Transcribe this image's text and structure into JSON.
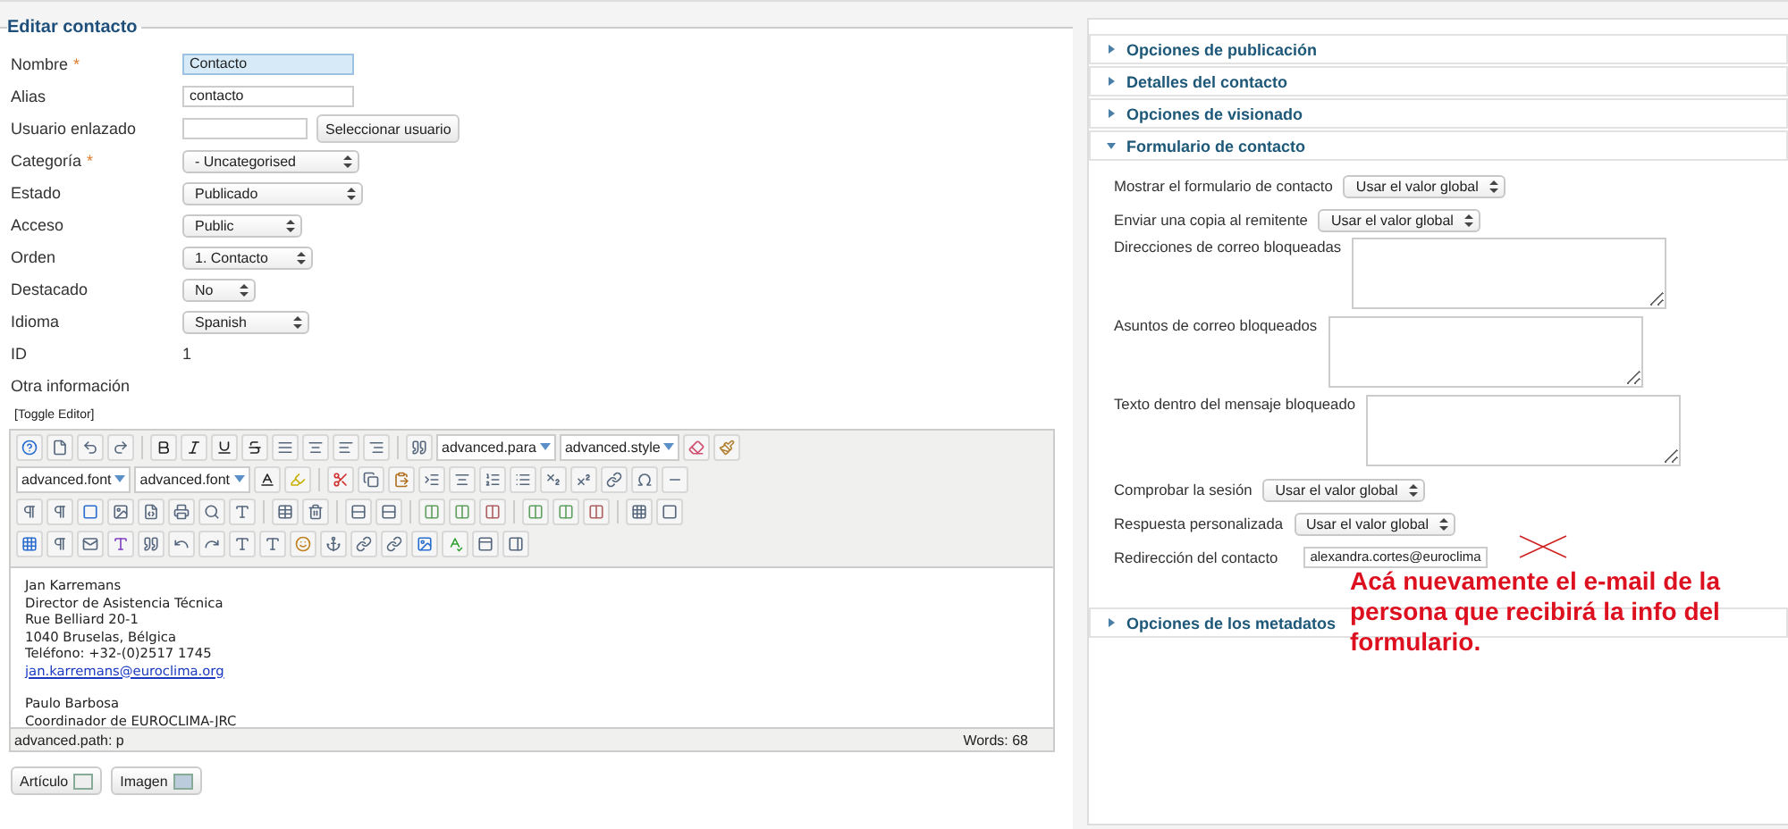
{
  "form": {
    "legend": "Editar contacto",
    "fields": [
      {
        "kind": "text",
        "label": "Nombre",
        "required_mark": "*",
        "value": "Contacto",
        "focused": true
      },
      {
        "kind": "text",
        "label": "Alias",
        "value": "contacto",
        "focused": false
      },
      {
        "kind": "user",
        "label": "Usuario enlazado",
        "button": "Seleccionar usuario"
      },
      {
        "kind": "select",
        "label": "Categoría",
        "required_mark": "*",
        "value": "- Uncategorised"
      },
      {
        "kind": "select",
        "label": "Estado",
        "value": "Publicado"
      },
      {
        "kind": "select",
        "label": "Acceso",
        "value": "Public"
      },
      {
        "kind": "select",
        "label": "Orden",
        "value": "1. Contacto"
      },
      {
        "kind": "select",
        "label": "Destacado",
        "value": "No"
      },
      {
        "kind": "select",
        "label": "Idioma",
        "value": "Spanish"
      },
      {
        "kind": "static",
        "label": "ID",
        "value": "1"
      },
      {
        "kind": "heading",
        "label": "Otra información"
      }
    ]
  },
  "editor": {
    "toggle": "[Toggle Editor]",
    "dropdowns": [
      "advanced.para",
      "advanced.style",
      "advanced.font",
      "advanced.font"
    ],
    "blocks": [
      {
        "lines": [
          "Jan Karremans",
          "Director de Asistencia Técnica",
          "Rue Belliard 20-1",
          "1040 Bruselas, Bélgica",
          "Teléfono: +32-(0)2517 1745"
        ],
        "link": "jan.karremans@euroclima.org"
      },
      {
        "lines": [
          "Paulo Barbosa",
          "Coordinador de EUROCLIMA-JRC"
        ]
      }
    ],
    "path": "advanced.path: p",
    "words": "Words: 68"
  },
  "buttons": [
    {
      "label": "Artículo"
    },
    {
      "label": "Imagen"
    }
  ],
  "panels": [
    {
      "title": "Opciones de publicación",
      "expanded": false
    },
    {
      "title": "Detalles del contacto",
      "expanded": false
    },
    {
      "title": "Opciones de visionado",
      "expanded": false
    },
    {
      "title": "Formulario de contacto",
      "expanded": true,
      "fields": [
        {
          "kind": "select",
          "label": "Mostrar el formulario de contacto",
          "value": "Usar el valor global"
        },
        {
          "kind": "select",
          "label": "Enviar una copia al remitente",
          "value": "Usar el valor global"
        },
        {
          "kind": "textarea",
          "label": "Direcciones de correo bloqueadas"
        },
        {
          "kind": "textarea",
          "label": "Asuntos de correo bloqueados"
        },
        {
          "kind": "textarea",
          "label": "Texto dentro del mensaje bloqueado"
        },
        {
          "kind": "select",
          "label": "Comprobar la sesión",
          "value": "Usar el valor global"
        },
        {
          "kind": "select",
          "label": "Respuesta personalizada",
          "value": "Usar el valor global"
        },
        {
          "kind": "text",
          "label": "Redirección del contacto",
          "value": "alexandra.cortes@euroclima"
        }
      ]
    },
    {
      "title": "Opciones de los metadatos",
      "expanded": false
    }
  ],
  "annotation": {
    "text": "Acá nuevamente el e-mail de la persona que recibirá la info del formulario."
  }
}
